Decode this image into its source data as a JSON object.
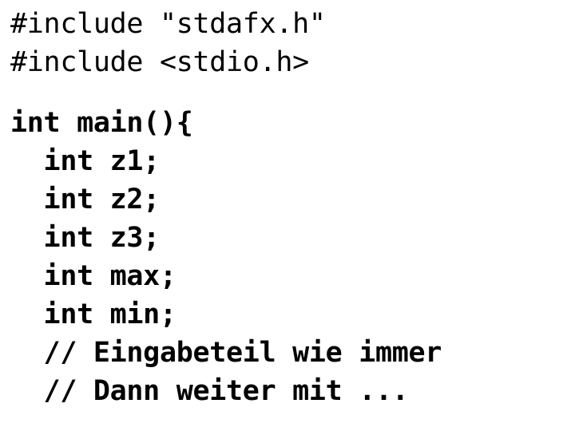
{
  "document": {
    "kind": "source-code-slide",
    "language": "c",
    "background_color": "#ffffff",
    "text_color": "#000000",
    "code_lines": [
      {
        "text": "#include \"stdafx.h\"",
        "weight": "regular",
        "blank": false
      },
      {
        "text": "#include <stdio.h>",
        "weight": "regular",
        "blank": false
      },
      {
        "text": "",
        "weight": "regular",
        "blank": true
      },
      {
        "text": "int main(){",
        "weight": "bold",
        "blank": false
      },
      {
        "text": "  int z1;",
        "weight": "bold",
        "blank": false
      },
      {
        "text": "  int z2;",
        "weight": "bold",
        "blank": false
      },
      {
        "text": "  int z3;",
        "weight": "bold",
        "blank": false
      },
      {
        "text": "  int max;",
        "weight": "bold",
        "blank": false
      },
      {
        "text": "  int min;",
        "weight": "bold",
        "blank": false
      },
      {
        "text": "  // Eingabeteil wie immer",
        "weight": "bold",
        "blank": false
      },
      {
        "text": "  // Dann weiter mit ...",
        "weight": "bold",
        "blank": false
      }
    ]
  }
}
